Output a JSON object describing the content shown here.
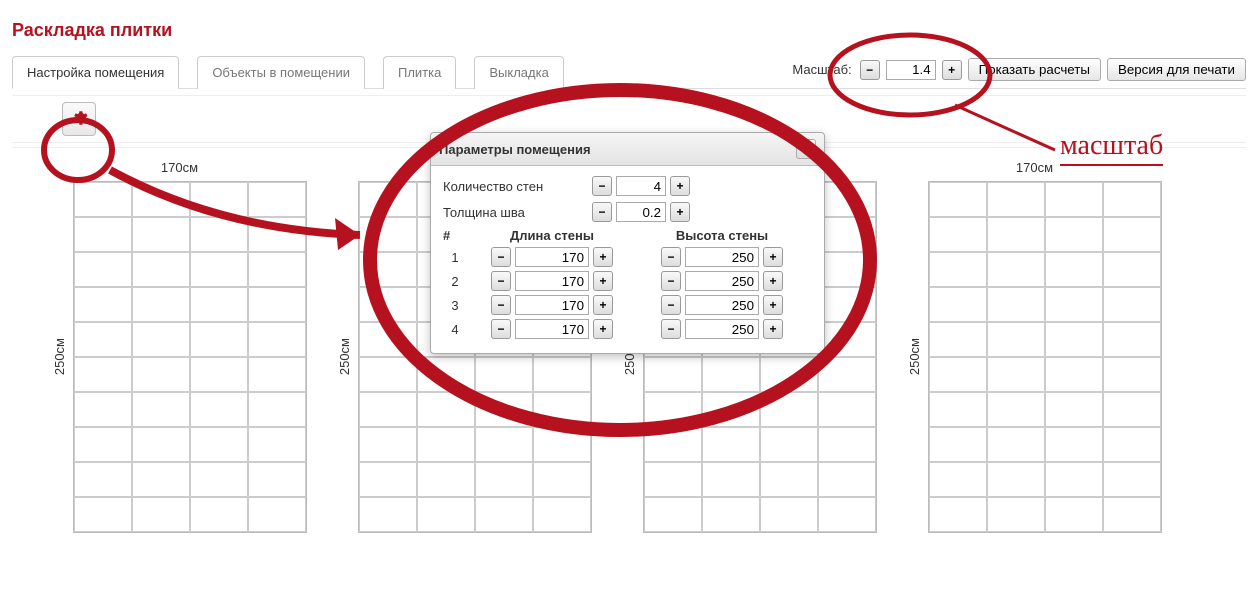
{
  "title": "Раскладка плитки",
  "tabs": [
    "Настройка помещения",
    "Объекты в помещении",
    "Плитка",
    "Выкладка"
  ],
  "scale": {
    "label": "Масштаб:",
    "value": "1.4"
  },
  "buttons": {
    "show_calc": "Показать расчеты",
    "print_version": "Версия для печати"
  },
  "walls_preview": {
    "width_label": "170см",
    "height_label": "250см"
  },
  "dialog": {
    "title": "Параметры помещения",
    "wall_count_label": "Количество стен",
    "wall_count_value": "4",
    "seam_label": "Толщина шва",
    "seam_value": "0.2",
    "col_index": "#",
    "col_length": "Длина стены",
    "col_height": "Высота стены",
    "rows": [
      {
        "idx": "1",
        "len": "170",
        "h": "250"
      },
      {
        "idx": "2",
        "len": "170",
        "h": "250"
      },
      {
        "idx": "3",
        "len": "170",
        "h": "250"
      },
      {
        "idx": "4",
        "len": "170",
        "h": "250"
      }
    ]
  },
  "annotation": {
    "scale_callout": "масштаб"
  }
}
